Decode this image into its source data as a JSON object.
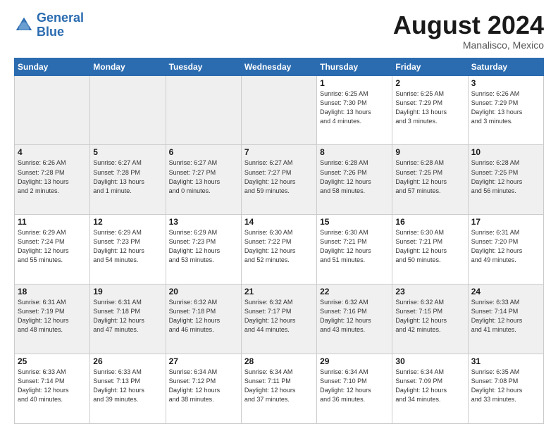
{
  "header": {
    "logo_line1": "General",
    "logo_line2": "Blue",
    "month_title": "August 2024",
    "subtitle": "Manalisco, Mexico"
  },
  "days_of_week": [
    "Sunday",
    "Monday",
    "Tuesday",
    "Wednesday",
    "Thursday",
    "Friday",
    "Saturday"
  ],
  "weeks": [
    {
      "days": [
        {
          "number": "",
          "info": "",
          "empty": true
        },
        {
          "number": "",
          "info": "",
          "empty": true
        },
        {
          "number": "",
          "info": "",
          "empty": true
        },
        {
          "number": "",
          "info": "",
          "empty": true
        },
        {
          "number": "1",
          "info": "Sunrise: 6:25 AM\nSunset: 7:30 PM\nDaylight: 13 hours\nand 4 minutes.",
          "empty": false
        },
        {
          "number": "2",
          "info": "Sunrise: 6:25 AM\nSunset: 7:29 PM\nDaylight: 13 hours\nand 3 minutes.",
          "empty": false
        },
        {
          "number": "3",
          "info": "Sunrise: 6:26 AM\nSunset: 7:29 PM\nDaylight: 13 hours\nand 3 minutes.",
          "empty": false
        }
      ]
    },
    {
      "days": [
        {
          "number": "4",
          "info": "Sunrise: 6:26 AM\nSunset: 7:28 PM\nDaylight: 13 hours\nand 2 minutes.",
          "empty": false
        },
        {
          "number": "5",
          "info": "Sunrise: 6:27 AM\nSunset: 7:28 PM\nDaylight: 13 hours\nand 1 minute.",
          "empty": false
        },
        {
          "number": "6",
          "info": "Sunrise: 6:27 AM\nSunset: 7:27 PM\nDaylight: 13 hours\nand 0 minutes.",
          "empty": false
        },
        {
          "number": "7",
          "info": "Sunrise: 6:27 AM\nSunset: 7:27 PM\nDaylight: 12 hours\nand 59 minutes.",
          "empty": false
        },
        {
          "number": "8",
          "info": "Sunrise: 6:28 AM\nSunset: 7:26 PM\nDaylight: 12 hours\nand 58 minutes.",
          "empty": false
        },
        {
          "number": "9",
          "info": "Sunrise: 6:28 AM\nSunset: 7:25 PM\nDaylight: 12 hours\nand 57 minutes.",
          "empty": false
        },
        {
          "number": "10",
          "info": "Sunrise: 6:28 AM\nSunset: 7:25 PM\nDaylight: 12 hours\nand 56 minutes.",
          "empty": false
        }
      ]
    },
    {
      "days": [
        {
          "number": "11",
          "info": "Sunrise: 6:29 AM\nSunset: 7:24 PM\nDaylight: 12 hours\nand 55 minutes.",
          "empty": false
        },
        {
          "number": "12",
          "info": "Sunrise: 6:29 AM\nSunset: 7:23 PM\nDaylight: 12 hours\nand 54 minutes.",
          "empty": false
        },
        {
          "number": "13",
          "info": "Sunrise: 6:29 AM\nSunset: 7:23 PM\nDaylight: 12 hours\nand 53 minutes.",
          "empty": false
        },
        {
          "number": "14",
          "info": "Sunrise: 6:30 AM\nSunset: 7:22 PM\nDaylight: 12 hours\nand 52 minutes.",
          "empty": false
        },
        {
          "number": "15",
          "info": "Sunrise: 6:30 AM\nSunset: 7:21 PM\nDaylight: 12 hours\nand 51 minutes.",
          "empty": false
        },
        {
          "number": "16",
          "info": "Sunrise: 6:30 AM\nSunset: 7:21 PM\nDaylight: 12 hours\nand 50 minutes.",
          "empty": false
        },
        {
          "number": "17",
          "info": "Sunrise: 6:31 AM\nSunset: 7:20 PM\nDaylight: 12 hours\nand 49 minutes.",
          "empty": false
        }
      ]
    },
    {
      "days": [
        {
          "number": "18",
          "info": "Sunrise: 6:31 AM\nSunset: 7:19 PM\nDaylight: 12 hours\nand 48 minutes.",
          "empty": false
        },
        {
          "number": "19",
          "info": "Sunrise: 6:31 AM\nSunset: 7:18 PM\nDaylight: 12 hours\nand 47 minutes.",
          "empty": false
        },
        {
          "number": "20",
          "info": "Sunrise: 6:32 AM\nSunset: 7:18 PM\nDaylight: 12 hours\nand 46 minutes.",
          "empty": false
        },
        {
          "number": "21",
          "info": "Sunrise: 6:32 AM\nSunset: 7:17 PM\nDaylight: 12 hours\nand 44 minutes.",
          "empty": false
        },
        {
          "number": "22",
          "info": "Sunrise: 6:32 AM\nSunset: 7:16 PM\nDaylight: 12 hours\nand 43 minutes.",
          "empty": false
        },
        {
          "number": "23",
          "info": "Sunrise: 6:32 AM\nSunset: 7:15 PM\nDaylight: 12 hours\nand 42 minutes.",
          "empty": false
        },
        {
          "number": "24",
          "info": "Sunrise: 6:33 AM\nSunset: 7:14 PM\nDaylight: 12 hours\nand 41 minutes.",
          "empty": false
        }
      ]
    },
    {
      "days": [
        {
          "number": "25",
          "info": "Sunrise: 6:33 AM\nSunset: 7:14 PM\nDaylight: 12 hours\nand 40 minutes.",
          "empty": false
        },
        {
          "number": "26",
          "info": "Sunrise: 6:33 AM\nSunset: 7:13 PM\nDaylight: 12 hours\nand 39 minutes.",
          "empty": false
        },
        {
          "number": "27",
          "info": "Sunrise: 6:34 AM\nSunset: 7:12 PM\nDaylight: 12 hours\nand 38 minutes.",
          "empty": false
        },
        {
          "number": "28",
          "info": "Sunrise: 6:34 AM\nSunset: 7:11 PM\nDaylight: 12 hours\nand 37 minutes.",
          "empty": false
        },
        {
          "number": "29",
          "info": "Sunrise: 6:34 AM\nSunset: 7:10 PM\nDaylight: 12 hours\nand 36 minutes.",
          "empty": false
        },
        {
          "number": "30",
          "info": "Sunrise: 6:34 AM\nSunset: 7:09 PM\nDaylight: 12 hours\nand 34 minutes.",
          "empty": false
        },
        {
          "number": "31",
          "info": "Sunrise: 6:35 AM\nSunset: 7:08 PM\nDaylight: 12 hours\nand 33 minutes.",
          "empty": false
        }
      ]
    }
  ]
}
